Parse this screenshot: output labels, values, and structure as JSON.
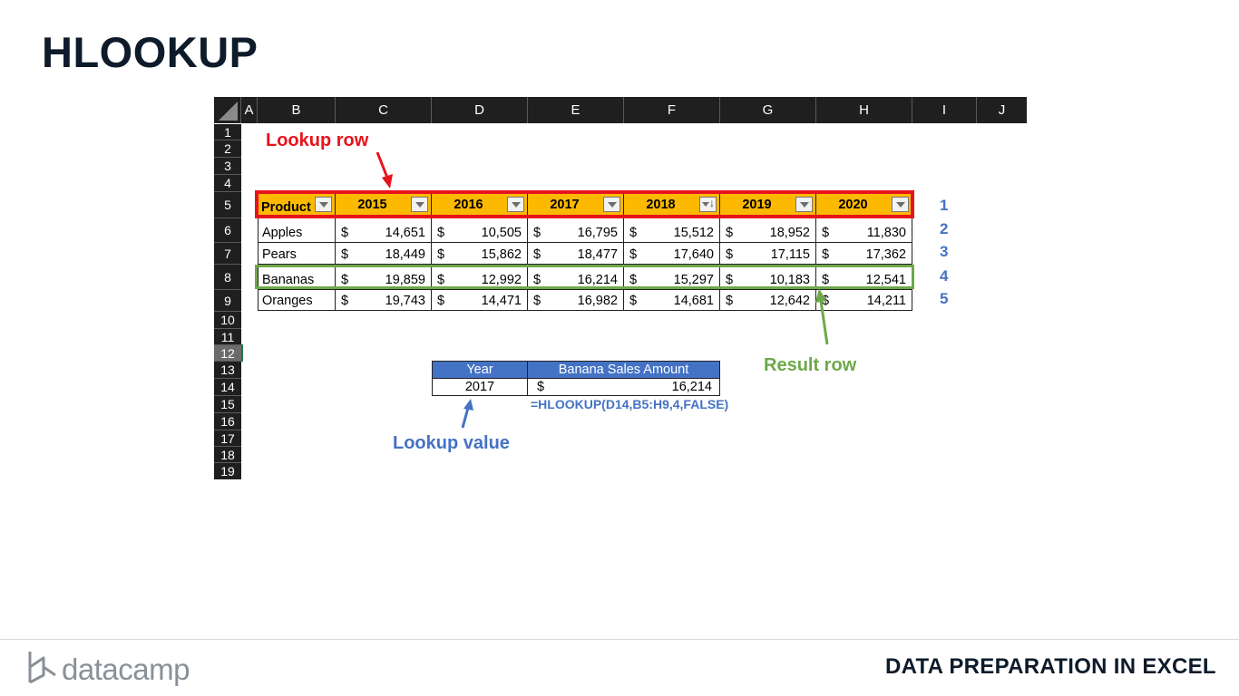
{
  "slide_title": "HLOOKUP",
  "columns": [
    "A",
    "B",
    "C",
    "D",
    "E",
    "F",
    "G",
    "H",
    "I",
    "J"
  ],
  "rows": [
    "1",
    "2",
    "3",
    "4",
    "5",
    "6",
    "7",
    "8",
    "9",
    "10",
    "11",
    "12",
    "13",
    "14",
    "15",
    "16",
    "17",
    "18",
    "19"
  ],
  "table": {
    "header_product": "Product",
    "years": [
      "2015",
      "2016",
      "2017",
      "2018",
      "2019",
      "2020"
    ],
    "currency": "$",
    "products": [
      {
        "name": "Apples",
        "values": [
          "14,651",
          "10,505",
          "16,795",
          "15,512",
          "18,952",
          "11,830"
        ]
      },
      {
        "name": "Pears",
        "values": [
          "18,449",
          "15,862",
          "18,477",
          "17,640",
          "17,115",
          "17,362"
        ]
      },
      {
        "name": "Bananas",
        "values": [
          "19,859",
          "12,992",
          "16,214",
          "15,297",
          "10,183",
          "12,541"
        ]
      },
      {
        "name": "Oranges",
        "values": [
          "19,743",
          "14,471",
          "16,982",
          "14,681",
          "12,642",
          "14,211"
        ]
      }
    ]
  },
  "row_indexes": [
    "1",
    "2",
    "3",
    "4",
    "5"
  ],
  "lookup_table": {
    "header_year": "Year",
    "header_amount": "Banana Sales Amount",
    "year_value": "2017",
    "currency": "$",
    "amount_value": "16,214",
    "formula": "=HLOOKUP(D14,B5:H9,4,FALSE)"
  },
  "annotations": {
    "lookup_row": "Lookup row",
    "result_row": "Result row",
    "lookup_value": "Lookup value"
  },
  "colors": {
    "header_fill": "#fdb900",
    "lookup_highlight": "#e8121b",
    "result_highlight": "#6ea84a",
    "accent_blue": "#4472c4"
  },
  "footer": {
    "brand": "datacamp",
    "course": "DATA PREPARATION IN EXCEL"
  }
}
